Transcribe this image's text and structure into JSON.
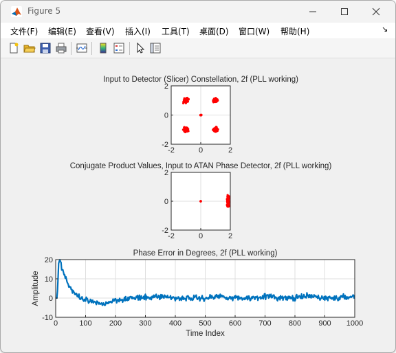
{
  "window": {
    "title": "Figure 5",
    "buttons": [
      "minimize",
      "maximize",
      "close"
    ]
  },
  "menu": {
    "items": [
      "文件(F)",
      "编辑(E)",
      "查看(V)",
      "插入(I)",
      "工具(T)",
      "桌面(D)",
      "窗口(W)",
      "帮助(H)"
    ],
    "dock_arrow": "↘"
  },
  "toolbar": {
    "icons": [
      "new-figure-icon",
      "open-file-icon",
      "save-icon",
      "print-icon",
      "link-plot-icon",
      "insert-colorbar-icon",
      "insert-legend-icon",
      "edit-plot-arrow-icon",
      "property-inspector-icon"
    ]
  },
  "chart_data": [
    {
      "type": "scatter",
      "title": "Input to Detector (Slicer) Constellation, 2f (PLL working)",
      "xlim": [
        -2,
        2
      ],
      "ylim": [
        -2,
        2
      ],
      "xticks": [
        "-2",
        "0",
        "2"
      ],
      "yticks": [
        "2",
        "0",
        "-2"
      ],
      "grid": true,
      "color": "#ff0000",
      "clusters": [
        {
          "x": -1.0,
          "y": 1.0,
          "spread": 0.22
        },
        {
          "x": 1.0,
          "y": 1.0,
          "spread": 0.22
        },
        {
          "x": -1.0,
          "y": -1.0,
          "spread": 0.22
        },
        {
          "x": 1.0,
          "y": -1.0,
          "spread": 0.22
        },
        {
          "x": 0.0,
          "y": 0.0,
          "spread": 0.06
        }
      ]
    },
    {
      "type": "scatter",
      "title": "Conjugate Product Values, Input to ATAN Phase Detector, 2f (PLL working)",
      "xlim": [
        -2,
        2
      ],
      "ylim": [
        -2,
        2
      ],
      "xticks": [
        "-2",
        "0",
        "2"
      ],
      "yticks": [
        "2",
        "0",
        "-2"
      ],
      "grid": true,
      "color": "#ff0000",
      "clusters": [
        {
          "x": 1.85,
          "y": 0.0,
          "spread_x": 0.12,
          "spread_y": 0.55
        },
        {
          "x": 0.0,
          "y": 0.0,
          "spread_x": 0.02,
          "spread_y": 0.02
        }
      ]
    },
    {
      "type": "line",
      "title": "Phase Error in Degrees, 2f (PLL working)",
      "xlabel": "Time Index",
      "ylabel": "Amplitude",
      "xlim": [
        0,
        1000
      ],
      "ylim": [
        -10,
        20
      ],
      "xticks": [
        "0",
        "100",
        "200",
        "300",
        "400",
        "500",
        "600",
        "700",
        "800",
        "900",
        "1000"
      ],
      "yticks": [
        "20",
        "10",
        "0",
        "-10"
      ],
      "grid": true,
      "color": "#0072bd",
      "series": [
        {
          "x": [
            0,
            5,
            10,
            15,
            20,
            30,
            40,
            50,
            60,
            70,
            80,
            90,
            100,
            120,
            140,
            160,
            180,
            200,
            250,
            300,
            350,
            400,
            450,
            500,
            550,
            600,
            650,
            700,
            750,
            800,
            850,
            900,
            950,
            1000
          ],
          "values": [
            0,
            0,
            18,
            20,
            16,
            12,
            8,
            5,
            3,
            1,
            0,
            -1,
            -1,
            -2,
            -3,
            -3,
            -2,
            -1,
            0,
            0,
            1,
            0,
            0,
            0,
            1,
            0,
            0,
            1,
            0,
            0,
            1,
            0,
            0,
            1
          ]
        }
      ]
    }
  ]
}
